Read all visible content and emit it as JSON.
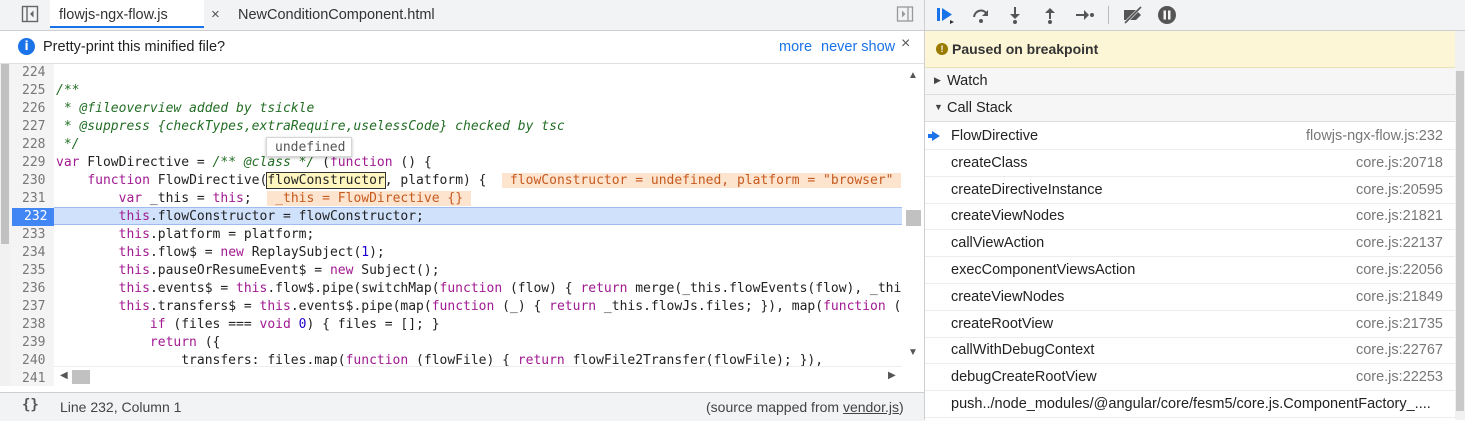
{
  "tabs": [
    {
      "label": "flowjs-ngx-flow.js",
      "active": true
    },
    {
      "label": "NewConditionComponent.html",
      "active": false
    }
  ],
  "tab_close": "×",
  "infobar": {
    "message": "Pretty-print this minified file?",
    "more": "more",
    "never_show": "never show",
    "close": "×",
    "info_glyph": "i"
  },
  "editor": {
    "current_line": 232,
    "lines": [
      {
        "n": "224",
        "html": ""
      },
      {
        "n": "225",
        "html": "<span class=\"cmt\">/**</span>"
      },
      {
        "n": "226",
        "html": "<span class=\"cmt\"> * @fileoverview added by tsickle</span>"
      },
      {
        "n": "227",
        "html": "<span class=\"cmt\"> * @suppress {checkTypes,extraRequire,uselessCode} checked by tsc</span>"
      },
      {
        "n": "228",
        "html": "<span class=\"cmt\"> */</span>"
      },
      {
        "n": "229",
        "html": "<span class=\"kw\">var</span> FlowDirective = <span class=\"cmt\">/** @class */</span> (<span class=\"kw\">function</span> () {"
      },
      {
        "n": "230",
        "html": "    <span class=\"kw\">function</span> FlowDirective(<span class=\"hl-box\">flowConstructor</span>, platform) {  <span class=\"inline-val\"> flowConstructor = undefined, platform = \"browser\" </span>"
      },
      {
        "n": "231",
        "html": "        <span class=\"kw\">var</span> _this = <span class=\"kw\">this</span>;  <span class=\"inline-val\"> _this = FlowDirective {} </span>"
      },
      {
        "n": "232",
        "html": "        <span class=\"kw\">this</span>.flowConstructor = flowConstructor;"
      },
      {
        "n": "233",
        "html": "        <span class=\"kw\">this</span>.platform = platform;"
      },
      {
        "n": "234",
        "html": "        <span class=\"kw\">this</span>.flow$ = <span class=\"kw\">new</span> ReplaySubject(<span class=\"num\">1</span>);"
      },
      {
        "n": "235",
        "html": "        <span class=\"kw\">this</span>.pauseOrResumeEvent$ = <span class=\"kw\">new</span> Subject();"
      },
      {
        "n": "236",
        "html": "        <span class=\"kw\">this</span>.events$ = <span class=\"kw\">this</span>.flow$.pipe(switchMap(<span class=\"kw\">function</span> (flow) { <span class=\"kw\">return</span> merge(_this.flowEvents(flow), _this.pauseOrResumeEvent$); }));"
      },
      {
        "n": "237",
        "html": "        <span class=\"kw\">this</span>.transfers$ = <span class=\"kw\">this</span>.events$.pipe(map(<span class=\"kw\">function</span> (_) { <span class=\"kw\">return</span> _this.flowJs.files; }), map(<span class=\"kw\">function</span> (files) {"
      },
      {
        "n": "238",
        "html": "            <span class=\"kw\">if</span> (files === <span class=\"kw\">void</span> <span class=\"num\">0</span>) { files = []; }"
      },
      {
        "n": "239",
        "html": "            <span class=\"kw\">return</span> ({"
      },
      {
        "n": "240",
        "html": "                transfers: files.map(<span class=\"kw\">function</span> (flowFile) { <span class=\"kw\">return</span> flowFile2Transfer(flowFile); }),"
      },
      {
        "n": "241",
        "html": ""
      }
    ],
    "tooltip": "undefined"
  },
  "statusbar": {
    "braces": "{}",
    "position": "Line 232, Column 1",
    "source_prefix": "(source mapped from ",
    "source_file": "vendor.js",
    "source_suffix": ")"
  },
  "debugger": {
    "paused_text": "Paused on breakpoint",
    "watch_label": "Watch",
    "callstack_label": "Call Stack",
    "frames": [
      {
        "name": "FlowDirective",
        "loc": "flowjs-ngx-flow.js:232",
        "current": true
      },
      {
        "name": "createClass",
        "loc": "core.js:20718"
      },
      {
        "name": "createDirectiveInstance",
        "loc": "core.js:20595"
      },
      {
        "name": "createViewNodes",
        "loc": "core.js:21821"
      },
      {
        "name": "callViewAction",
        "loc": "core.js:22137"
      },
      {
        "name": "execComponentViewsAction",
        "loc": "core.js:22056"
      },
      {
        "name": "createViewNodes",
        "loc": "core.js:21849"
      },
      {
        "name": "createRootView",
        "loc": "core.js:21735"
      },
      {
        "name": "callWithDebugContext",
        "loc": "core.js:22767"
      },
      {
        "name": "debugCreateRootView",
        "loc": "core.js:22253"
      },
      {
        "name": "push../node_modules/@angular/core/fesm5/core.js.ComponentFactory_....",
        "loc": ""
      }
    ]
  },
  "colors": {
    "accent": "#1a73e8",
    "paused_bg": "#fcf6d6",
    "exec_line": "#cfe1fb",
    "current_line_number": "#4285f4"
  },
  "icons": [
    "navigator-toggle-icon",
    "debugger-panel-toggle-icon",
    "info-icon",
    "resume-icon",
    "step-over-icon",
    "step-into-icon",
    "step-out-icon",
    "step-icon",
    "deactivate-breakpoints-icon",
    "pause-on-exceptions-icon",
    "warning-icon",
    "current-frame-arrow-icon"
  ]
}
